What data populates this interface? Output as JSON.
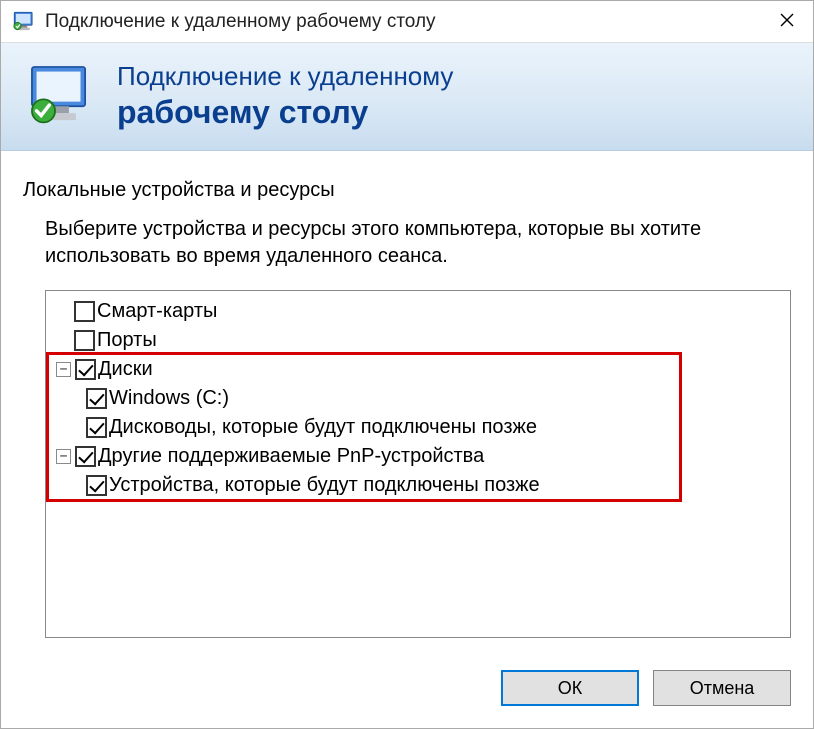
{
  "window": {
    "title": "Подключение к удаленному рабочему столу"
  },
  "banner": {
    "line1": "Подключение к удаленному",
    "line2": "рабочему столу"
  },
  "section": {
    "title": "Локальные устройства и ресурсы",
    "description": "Выберите устройства и ресурсы этого компьютера, которые вы хотите использовать во время удаленного сеанса."
  },
  "tree": {
    "items": [
      {
        "label": "Смарт-карты",
        "checked": false,
        "level": 0,
        "expander": null
      },
      {
        "label": "Порты",
        "checked": false,
        "level": 0,
        "expander": null
      },
      {
        "label": "Диски",
        "checked": true,
        "level": 1,
        "expander": "−"
      },
      {
        "label": "Windows (C:)",
        "checked": true,
        "level": 2,
        "expander": null
      },
      {
        "label": "Дисководы, которые будут подключены позже",
        "checked": true,
        "level": 2,
        "expander": null
      },
      {
        "label": "Другие поддерживаемые PnP-устройства",
        "checked": true,
        "level": 1,
        "expander": "−"
      },
      {
        "label": "Устройства, которые будут подключены позже",
        "checked": true,
        "level": 2,
        "expander": null
      }
    ]
  },
  "buttons": {
    "ok": "ОК",
    "cancel": "Отмена"
  }
}
